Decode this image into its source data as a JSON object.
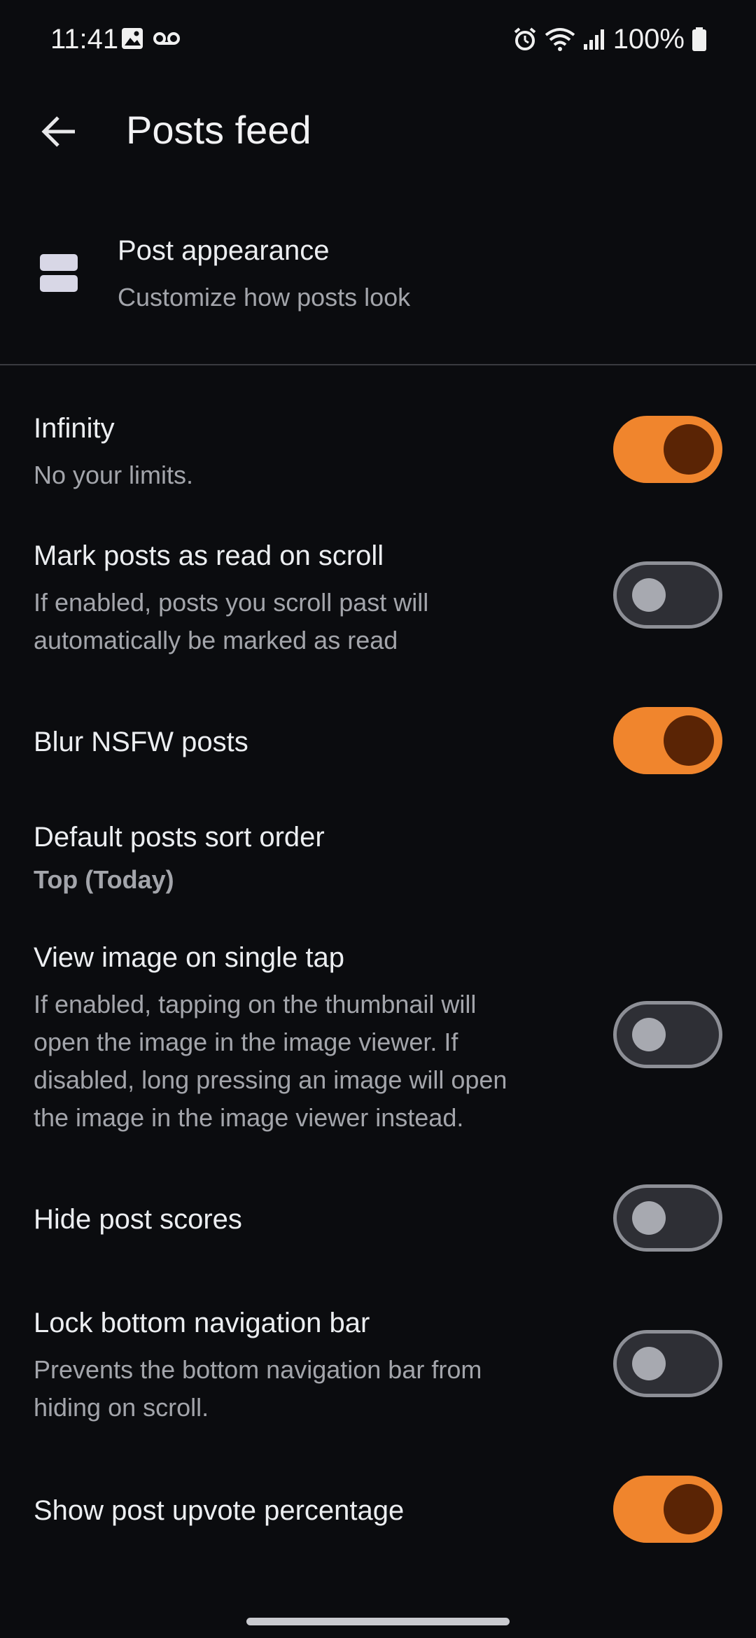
{
  "status_bar": {
    "time": "11:41",
    "battery": "100%"
  },
  "header": {
    "title": "Posts feed"
  },
  "appearance": {
    "title": "Post appearance",
    "subtitle": "Customize how posts look"
  },
  "settings": [
    {
      "title": "Infinity",
      "description": "No your limits.",
      "enabled": true
    },
    {
      "title": "Mark posts as read on scroll",
      "description_lines": [
        "If enabled, posts you scroll past will",
        "automatically be marked as read"
      ],
      "enabled": false
    },
    {
      "title": "Blur NSFW posts",
      "enabled": true
    },
    {
      "title": "Default posts sort order",
      "value": "Top (Today)"
    },
    {
      "title": "View image on single tap",
      "description_lines": [
        "If enabled, tapping on the thumbnail will",
        "open the image in the image viewer. If",
        "disabled, long pressing an image will open",
        "the image in the image viewer instead."
      ],
      "enabled": false
    },
    {
      "title": "Hide post scores",
      "enabled": false
    },
    {
      "title": "Lock bottom navigation bar",
      "description_lines": [
        "Prevents the bottom navigation bar from",
        "hiding on scroll."
      ],
      "enabled": false
    },
    {
      "title": "Show post upvote percentage",
      "enabled": true
    }
  ],
  "colors": {
    "accent": "#f0852d",
    "background": "#0b0c0f"
  }
}
